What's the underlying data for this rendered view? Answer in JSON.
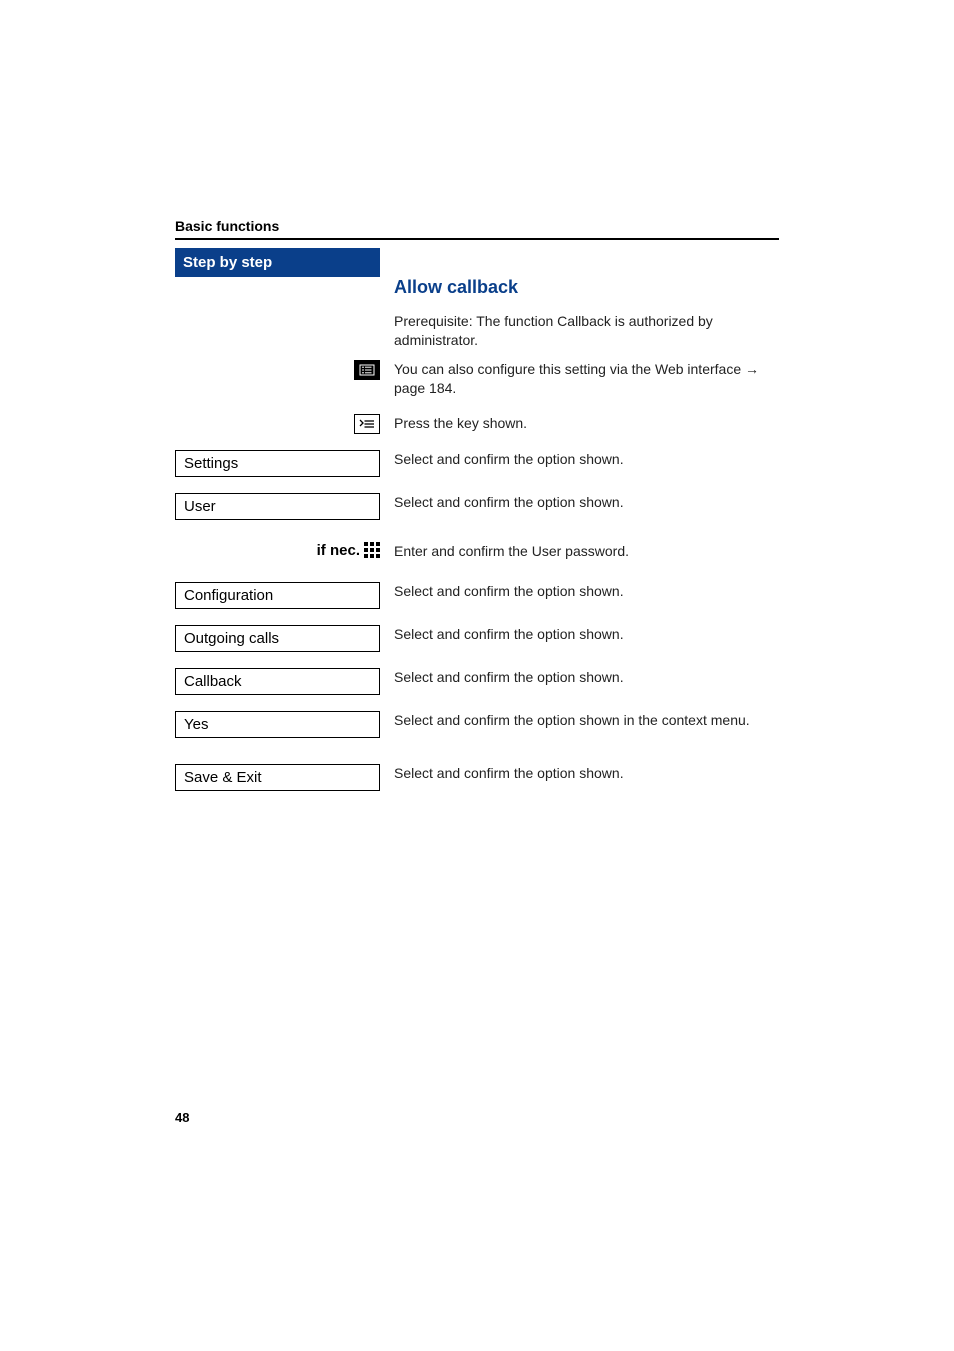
{
  "header": {
    "section": "Basic functions"
  },
  "left": {
    "banner": "Step by step",
    "ifnec_label": "if nec."
  },
  "title": "Allow callback",
  "intro": {
    "prereq": "Prerequisite: The function Callback is authorized by administrator.",
    "webconf_a": "You can also configure this setting via the Web interface ",
    "webconf_b": " page 184.",
    "press_key": "Press the key shown."
  },
  "steps": {
    "settings": {
      "label": "Settings",
      "desc": "Select and confirm the option shown."
    },
    "user": {
      "label": "User",
      "desc": "Select and confirm the option shown."
    },
    "password_desc": "Enter and confirm the User password.",
    "configuration": {
      "label": "Configuration",
      "desc": "Select and confirm the option shown."
    },
    "outgoing": {
      "label": "Outgoing calls",
      "desc": "Select and confirm the option shown."
    },
    "callback": {
      "label": "Callback",
      "desc": "Select and confirm the option shown."
    },
    "yes": {
      "label": "Yes",
      "desc": "Select and confirm the option shown in the context menu."
    },
    "save": {
      "label": "Save & Exit",
      "desc": "Select and confirm the option shown."
    }
  },
  "page_number": "48"
}
